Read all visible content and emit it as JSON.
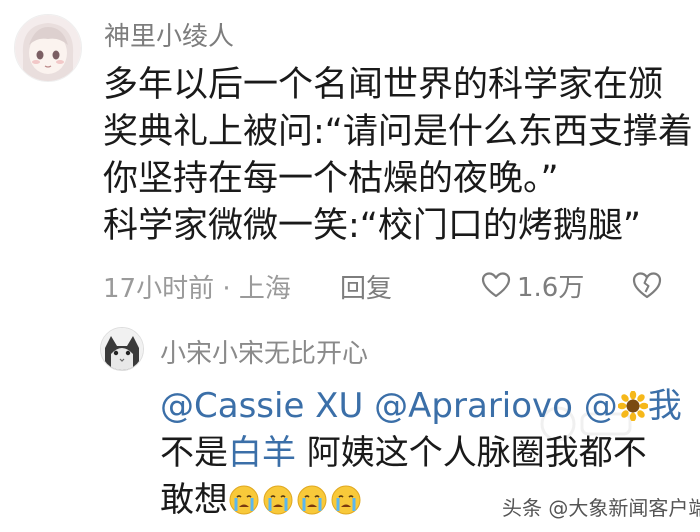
{
  "comment": {
    "username": "神里小绫人",
    "text_lines": [
      "多年以后一个名闻世界的科学家在颁",
      "奖典礼上被问:“请问是什么东西支撑着",
      "你坚持在每一个枯燥的夜晚。”",
      "科学家微微一笑:“校门口的烤鹅腿”"
    ],
    "time_location": "17小时前 · 上海",
    "reply_label": "回复",
    "like_count": "1.6万"
  },
  "reply": {
    "username": "小宋小宋无比开心",
    "line1_mentions": "@Cassie XU @Aprariovo @",
    "line1_tail": "我",
    "line2_start": "不是",
    "line2_mention": "白羊",
    "line2_rest": " 阿姨这个人脉圈我都不",
    "line3": "敢想"
  },
  "watermark": "头条 @大象新闻客户端",
  "colors": {
    "mention": "#3b6fa8",
    "text": "#1a1a1a",
    "meta": "#9a9a9a"
  }
}
